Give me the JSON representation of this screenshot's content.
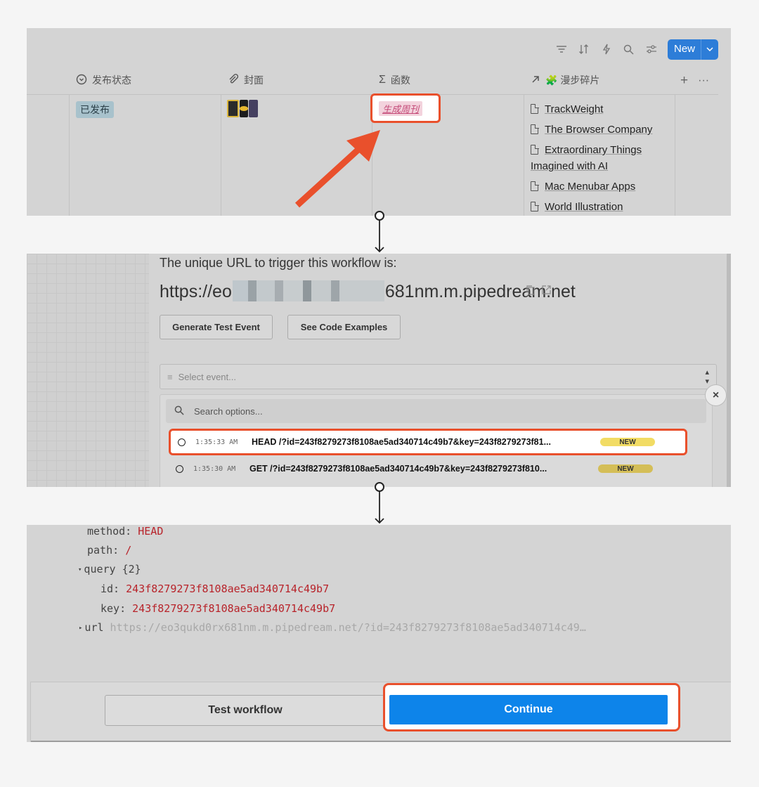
{
  "panel1": {
    "toolbar": {
      "new_label": "New"
    },
    "columns": [
      {
        "icon": "status-icon",
        "label": "发布状态"
      },
      {
        "icon": "attachment-icon",
        "label": "封面"
      },
      {
        "icon": "sigma-icon",
        "label": "函数"
      },
      {
        "icon": "relation-arrow-icon",
        "label": "🧩 漫步碎片"
      }
    ],
    "row": {
      "status": "已发布",
      "function_button": "生成周刊",
      "links": [
        "TrackWeight",
        "The Browser Company",
        "Extraordinary Things Imagined with AI",
        "Mac Menubar Apps",
        "World Illustration"
      ]
    },
    "colors": {
      "status_tag": "#a8c2cc",
      "function_tag": "#f3d3dd",
      "highlight": "#e9502c",
      "new_button": "#2d7dd8"
    }
  },
  "panel2": {
    "url_lead": "The unique URL to trigger this workflow is:",
    "url_prefix": "https://eo",
    "url_suffix": "681nm.m.pipedream.net",
    "buttons": {
      "generate": "Generate Test Event",
      "examples": "See Code Examples"
    },
    "select_placeholder": "Select event...",
    "search_placeholder": "Search options...",
    "events": [
      {
        "time": "1:35:33 AM",
        "request": "HEAD /?id=243f8279273f8108ae5ad340714c49b7&key=243f8279273f81...",
        "badge": "NEW",
        "badge_color": "#f2dc64"
      },
      {
        "time": "1:35:30 AM",
        "request": "GET /?id=243f8279273f8108ae5ad340714c49b7&key=243f8279273f810...",
        "badge": "NEW",
        "badge_color": "#d4be57"
      }
    ]
  },
  "panel3": {
    "method_key": "method:",
    "method_val": "HEAD",
    "path_key": "path:",
    "path_val": "/",
    "query_key": "query",
    "query_count": "{2}",
    "id_key": "id:",
    "id_val": "243f8279273f8108ae5ad340714c49b7",
    "keyk": "key:",
    "key_val": "243f8279273f8108ae5ad340714c49b7",
    "url_key": "url",
    "url_val": "https://eo3qukd0rx681nm.m.pipedream.net/?id=243f8279273f8108ae5ad340714c49…",
    "buttons": {
      "test": "Test workflow",
      "continue": "Continue"
    },
    "colors": {
      "continue": "#0d84ea"
    }
  }
}
